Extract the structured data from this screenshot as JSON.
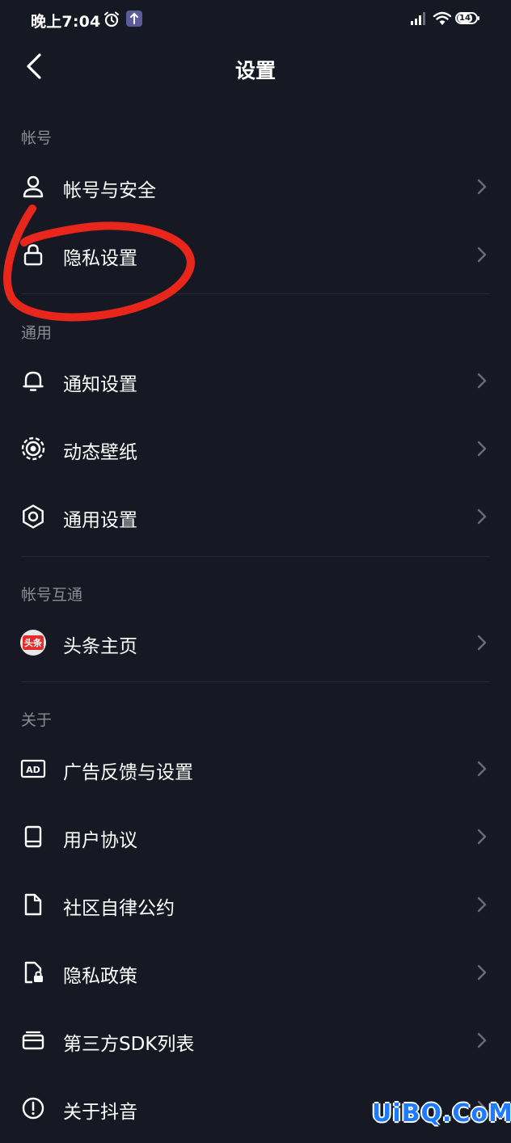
{
  "status_bar": {
    "time": "晚上7:04",
    "battery_level": "14",
    "icons": [
      "alarm-icon",
      "app-notification-icon",
      "signal-icon",
      "wifi-icon",
      "battery-icon"
    ]
  },
  "header": {
    "title": "设置",
    "back_icon": "chevron-left-icon"
  },
  "sections": [
    {
      "label": "帐号",
      "items": [
        {
          "label": "帐号与安全",
          "icon": "user-icon"
        },
        {
          "label": "隐私设置",
          "icon": "lock-icon"
        }
      ]
    },
    {
      "label": "通用",
      "items": [
        {
          "label": "通知设置",
          "icon": "bell-icon"
        },
        {
          "label": "动态壁纸",
          "icon": "live-wallpaper-icon"
        },
        {
          "label": "通用设置",
          "icon": "gear-icon"
        }
      ]
    },
    {
      "label": "帐号互通",
      "items": [
        {
          "label": "头条主页",
          "icon": "toutiao-logo-icon",
          "badge_text": "头条"
        }
      ]
    },
    {
      "label": "关于",
      "items": [
        {
          "label": "广告反馈与设置",
          "icon": "ad-icon",
          "icon_text": "AD"
        },
        {
          "label": "用户协议",
          "icon": "book-icon"
        },
        {
          "label": "社区自律公约",
          "icon": "document-icon"
        },
        {
          "label": "隐私政策",
          "icon": "document-lock-icon"
        },
        {
          "label": "第三方SDK列表",
          "icon": "card-stack-icon"
        },
        {
          "label": "关于抖音",
          "icon": "info-icon"
        }
      ]
    }
  ],
  "annotation": {
    "shape": "hand-drawn-circle",
    "color": "#e8261b",
    "target": "隐私设置"
  },
  "watermark": "UiBQ.CoM",
  "colors": {
    "background": "#161823",
    "text": "#ffffff",
    "section_label": "#8a8b93",
    "divider": "#262833",
    "annotation": "#e8261b"
  }
}
